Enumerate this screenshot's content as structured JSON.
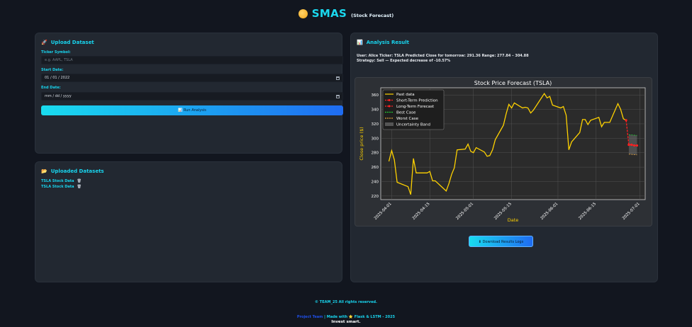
{
  "header": {
    "title": "SMAS",
    "subtitle": "(Stock Forecast)"
  },
  "upload": {
    "title": "Upload Dataset",
    "ticker_label": "Ticker Symbol:",
    "ticker_placeholder": "e.g. AAPL, TSLA",
    "start_label": "Start Date:",
    "start_value": "01 / 01 / 2022",
    "end_label": "End Date:",
    "end_value": "mm / dd / yyyy",
    "run_label": "Run Analysis"
  },
  "datasets": {
    "title": "Uploaded Datasets",
    "items": [
      "TSLA Stock Data",
      "TSLA Stock Data"
    ]
  },
  "analysis": {
    "title": "Analysis Result",
    "line1": "User: Alice Ticker: TSLA Predicted Close for tomorrow: 291.36 Range: 277.84 – 304.88",
    "line2": "Strategy: Sell — Expected decrease of -10.57%",
    "download_label": "Download Results Logs"
  },
  "chart_data": {
    "type": "line",
    "title": "Stock Price Forecast (TSLA)",
    "xlabel": "Date",
    "ylabel": "Close price ($)",
    "ylim": [
      215,
      370
    ],
    "xlim": [
      "2025-03-28",
      "2025-07-03"
    ],
    "xticks": [
      "2025-04-01",
      "2025-04-15",
      "2025-05-01",
      "2025-05-15",
      "2025-06-01",
      "2025-06-15",
      "2025-07-01"
    ],
    "yticks": [
      220,
      240,
      260,
      280,
      300,
      320,
      340,
      360
    ],
    "grid": true,
    "legend": "top-left",
    "series": [
      {
        "name": "Past data",
        "color": "#ffd200",
        "points": [
          [
            "2025-03-31",
            268
          ],
          [
            "2025-04-01",
            283
          ],
          [
            "2025-04-02",
            270
          ],
          [
            "2025-04-03",
            239
          ],
          [
            "2025-04-07",
            233
          ],
          [
            "2025-04-08",
            222
          ],
          [
            "2025-04-09",
            272
          ],
          [
            "2025-04-10",
            252
          ],
          [
            "2025-04-11",
            252
          ],
          [
            "2025-04-14",
            252
          ],
          [
            "2025-04-15",
            254
          ],
          [
            "2025-04-16",
            241
          ],
          [
            "2025-04-17",
            241
          ],
          [
            "2025-04-21",
            227
          ],
          [
            "2025-04-22",
            237
          ],
          [
            "2025-04-23",
            250
          ],
          [
            "2025-04-24",
            259
          ],
          [
            "2025-04-25",
            284
          ],
          [
            "2025-04-28",
            285
          ],
          [
            "2025-04-29",
            292
          ],
          [
            "2025-04-30",
            282
          ],
          [
            "2025-05-01",
            280
          ],
          [
            "2025-05-02",
            287
          ],
          [
            "2025-05-05",
            281
          ],
          [
            "2025-05-06",
            275
          ],
          [
            "2025-05-07",
            276
          ],
          [
            "2025-05-08",
            284
          ],
          [
            "2025-05-09",
            298
          ],
          [
            "2025-05-12",
            318
          ],
          [
            "2025-05-13",
            334
          ],
          [
            "2025-05-14",
            347
          ],
          [
            "2025-05-15",
            342
          ],
          [
            "2025-05-16",
            349
          ],
          [
            "2025-05-19",
            342
          ],
          [
            "2025-05-20",
            343
          ],
          [
            "2025-05-21",
            342
          ],
          [
            "2025-05-22",
            335
          ],
          [
            "2025-05-23",
            339
          ],
          [
            "2025-05-27",
            362
          ],
          [
            "2025-05-28",
            356
          ],
          [
            "2025-05-29",
            358
          ],
          [
            "2025-05-30",
            346
          ],
          [
            "2025-06-02",
            342
          ],
          [
            "2025-06-03",
            344
          ],
          [
            "2025-06-04",
            332
          ],
          [
            "2025-06-05",
            284
          ],
          [
            "2025-06-06",
            295
          ],
          [
            "2025-06-09",
            308
          ],
          [
            "2025-06-10",
            326
          ],
          [
            "2025-06-11",
            326
          ],
          [
            "2025-06-12",
            319
          ],
          [
            "2025-06-13",
            325
          ],
          [
            "2025-06-16",
            329
          ],
          [
            "2025-06-17",
            316
          ],
          [
            "2025-06-18",
            322
          ],
          [
            "2025-06-20",
            322
          ],
          [
            "2025-06-23",
            348
          ],
          [
            "2025-06-24",
            340
          ],
          [
            "2025-06-25",
            327
          ],
          [
            "2025-06-26",
            325
          ]
        ]
      },
      {
        "name": "Short-Term Prediction",
        "color": "#ff2020",
        "points": [
          [
            "2025-06-26",
            325
          ],
          [
            "2025-06-27",
            291
          ]
        ]
      },
      {
        "name": "Long-Term Forecast",
        "color": "#ff2020",
        "points": [
          [
            "2025-06-27",
            291
          ],
          [
            "2025-06-28",
            291
          ],
          [
            "2025-06-29",
            290
          ],
          [
            "2025-06-30",
            290
          ]
        ]
      },
      {
        "name": "Best Case",
        "color": "#22cc33",
        "points": [
          [
            "2025-06-27",
            305
          ],
          [
            "2025-06-30",
            304
          ]
        ]
      },
      {
        "name": "Worst Case",
        "color": "#e0a03c",
        "points": [
          [
            "2025-06-27",
            278
          ],
          [
            "2025-06-30",
            277
          ]
        ]
      },
      {
        "name": "Uncertainty Band",
        "color": "#555555",
        "points": [
          [
            "2025-06-27",
            278,
            305
          ],
          [
            "2025-06-30",
            277,
            304
          ]
        ]
      }
    ]
  },
  "footer": {
    "rights": "© TEAM_25 All rights reserved.",
    "dev": "Project Team",
    "made_prefix": " | Made with ",
    "made_suffix": " Flask & LSTM - 2025",
    "tagline": "Invest smart."
  }
}
